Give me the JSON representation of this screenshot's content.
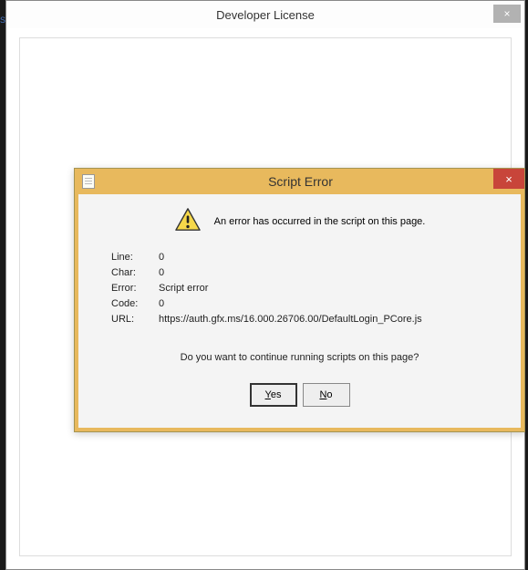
{
  "outer": {
    "title": "Developer License",
    "close": "×"
  },
  "dialog": {
    "title": "Script Error",
    "close": "×",
    "message": "An error has occurred in the script on this page.",
    "labels": {
      "line": "Line:",
      "char": "Char:",
      "error": "Error:",
      "code": "Code:",
      "url": "URL:"
    },
    "values": {
      "line": "0",
      "char": "0",
      "error": "Script error",
      "code": "0",
      "url": "https://auth.gfx.ms/16.000.26706.00/DefaultLogin_PCore.js"
    },
    "prompt": "Do you want to continue running scripts on this page?",
    "yes": "Yes",
    "no": "No"
  }
}
